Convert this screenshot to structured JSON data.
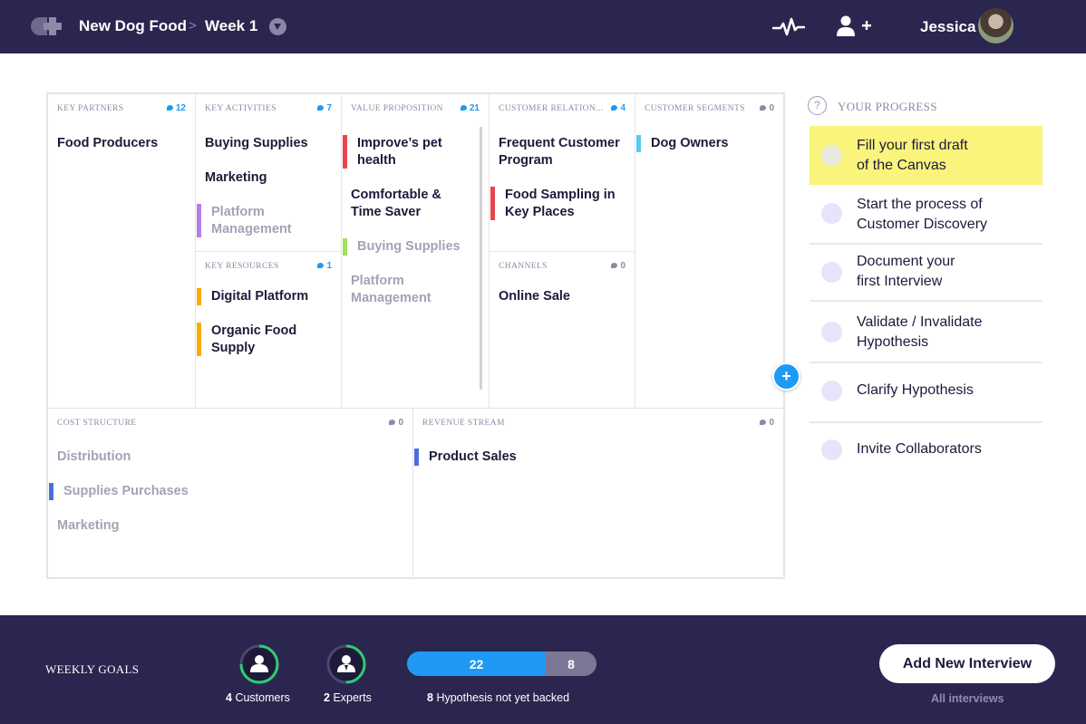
{
  "header": {
    "logo_icon": "plus-logo-icon",
    "project": "New Dog Food",
    "separator": ">",
    "week": "Week 1",
    "dropdown_icon": "chevron-down-icon",
    "activity_icon": "pulse-icon",
    "invite_icon": "add-user-icon",
    "user_name": "Jessica"
  },
  "canvas": {
    "key_partners": {
      "label": "KEY PARTNERS",
      "count": "12",
      "items": [
        "Food Producers"
      ]
    },
    "key_activities": {
      "label": "KEY ACTIVITIES",
      "count": "7",
      "items": [
        "Buying Supplies",
        "Marketing",
        "Platform Management"
      ]
    },
    "key_resources": {
      "label": "KEY RESOURCES",
      "count": "1",
      "items": [
        "Digital Platform",
        "Organic Food Supply"
      ]
    },
    "value_proposition": {
      "label": "VALUE PROPOSITION",
      "count": "21",
      "items": [
        "Improve’s pet health",
        "Comfortable & Time Saver",
        "Buying Supplies",
        "Platform Management"
      ]
    },
    "customer_relationships": {
      "label": "CUSTOMER RELATION...",
      "count": "4",
      "items": [
        "Frequent Customer Program",
        "Food Sampling in Key Places"
      ]
    },
    "channels": {
      "label": "CHANNELS",
      "count": "0",
      "items": [
        "Online Sale"
      ]
    },
    "customer_segments": {
      "label": "CUSTOMER SEGMENTS",
      "count": "0",
      "items": [
        "Dog Owners"
      ]
    },
    "cost_structure": {
      "label": "COST STRUCTURE",
      "count": "0",
      "items": [
        "Distribution",
        "Supplies Purchases",
        "Marketing"
      ]
    },
    "revenue_stream": {
      "label": "REVENUE STREAM",
      "count": "0",
      "items": [
        "Product Sales"
      ]
    },
    "add_button": "+"
  },
  "progress": {
    "help_icon": "?",
    "title": "YOUR PROGRESS",
    "steps": [
      "Fill your first draft\nof the Canvas",
      "Start the process of\nCustomer Discovery",
      "Document your\nfirst Interview",
      "Validate / Invalidate\nHypothesis",
      "Clarify Hypothesis",
      "Invite Collaborators"
    ]
  },
  "footer": {
    "title": "WEEKLY GOALS",
    "customers_count": "4",
    "customers_label": "Customers",
    "customers_progress": 0.75,
    "experts_count": "2",
    "experts_label": "Experts",
    "experts_progress": 0.5,
    "hypothesis_backed": "22",
    "hypothesis_unbacked": "8",
    "hypothesis_count": "8",
    "hypothesis_label": "Hypothesis not yet backed",
    "add_interview": "Add New Interview",
    "all_interviews": "All interviews",
    "colors": {
      "accent": "#1e9af5",
      "success": "#2ecc71",
      "navy": "#2b264f"
    }
  }
}
